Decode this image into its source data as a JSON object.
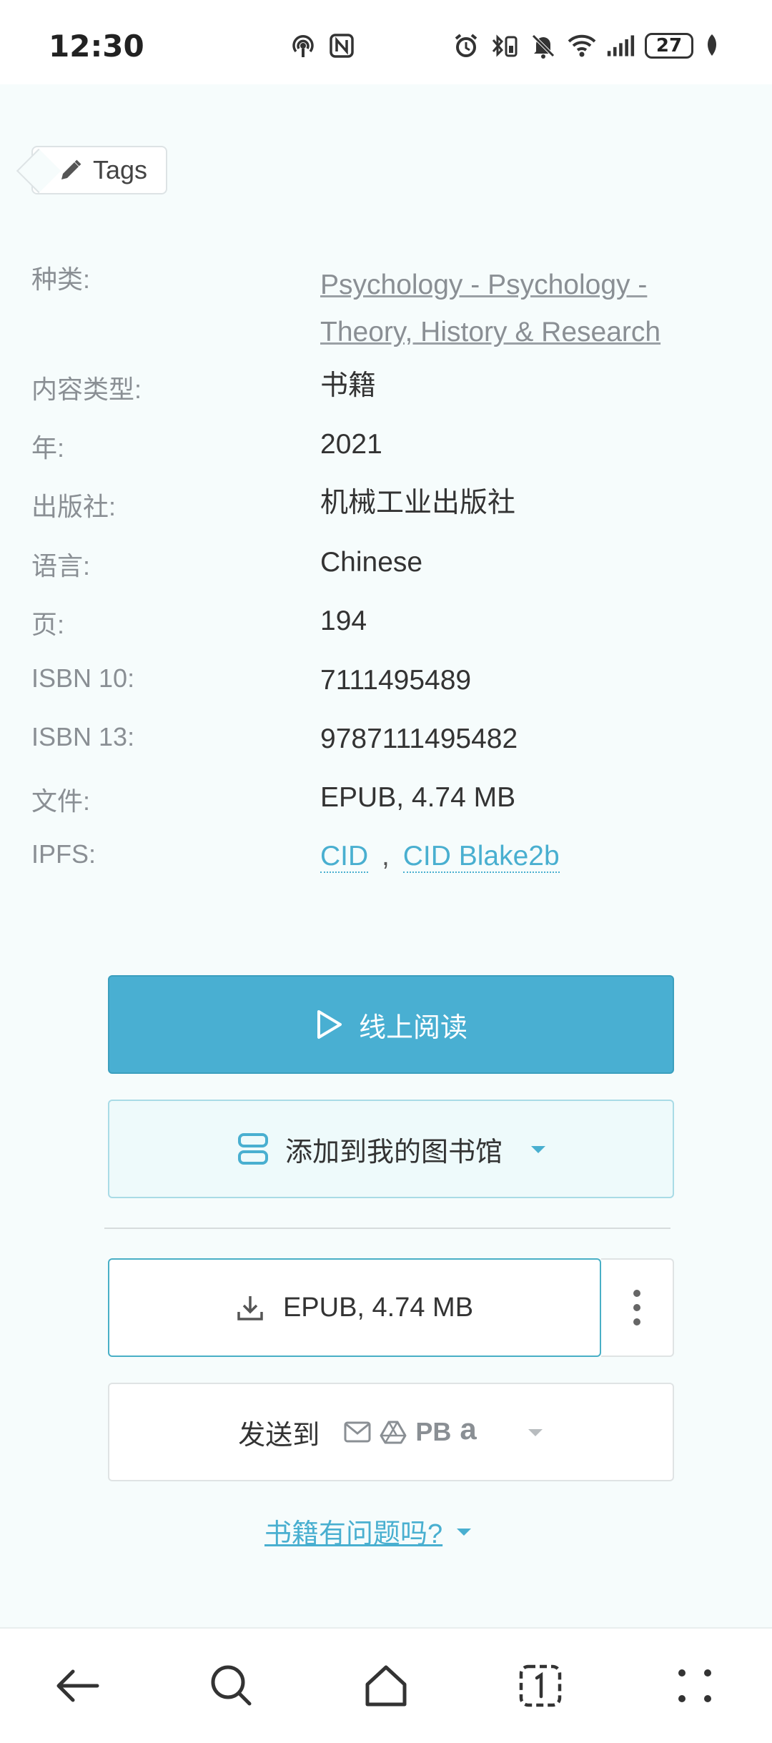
{
  "status_bar": {
    "time": "12:30",
    "battery": "27",
    "icons_left": [
      "hotspot-icon",
      "nfc-icon"
    ],
    "icons_right": [
      "alarm-icon",
      "bluetooth-battery-icon",
      "mute-icon",
      "wifi-icon",
      "signal-icon",
      "battery-icon",
      "leaf-icon"
    ]
  },
  "tags_label": "Tags",
  "properties": [
    {
      "label": "种类:",
      "value": "Psychology - Psychology - Theory, History & Research",
      "type": "link"
    },
    {
      "label": "内容类型:",
      "value": "书籍"
    },
    {
      "label": "年:",
      "value": "2021"
    },
    {
      "label": "出版社:",
      "value": "机械工业出版社"
    },
    {
      "label": "语言:",
      "value": "Chinese"
    },
    {
      "label": "页:",
      "value": "194"
    },
    {
      "label": "ISBN 10:",
      "value": "7111495489"
    },
    {
      "label": "ISBN 13:",
      "value": "9787111495482"
    },
    {
      "label": "文件:",
      "value": "EPUB, 4.74 MB"
    },
    {
      "label": "IPFS:",
      "cid": "CID",
      "separator": ",",
      "cid_blake": "CID Blake2b"
    }
  ],
  "actions": {
    "read_online": "线上阅读",
    "add_to_library": "添加到我的图书馆",
    "download": "EPUB, 4.74 MB",
    "send_to": "发送到",
    "send_pb": "PB",
    "send_amazon": "a",
    "problem": "书籍有问题吗?"
  },
  "colors": {
    "accent": "#49afd2",
    "background": "#f6fcfc",
    "label": "#8a8f94"
  }
}
